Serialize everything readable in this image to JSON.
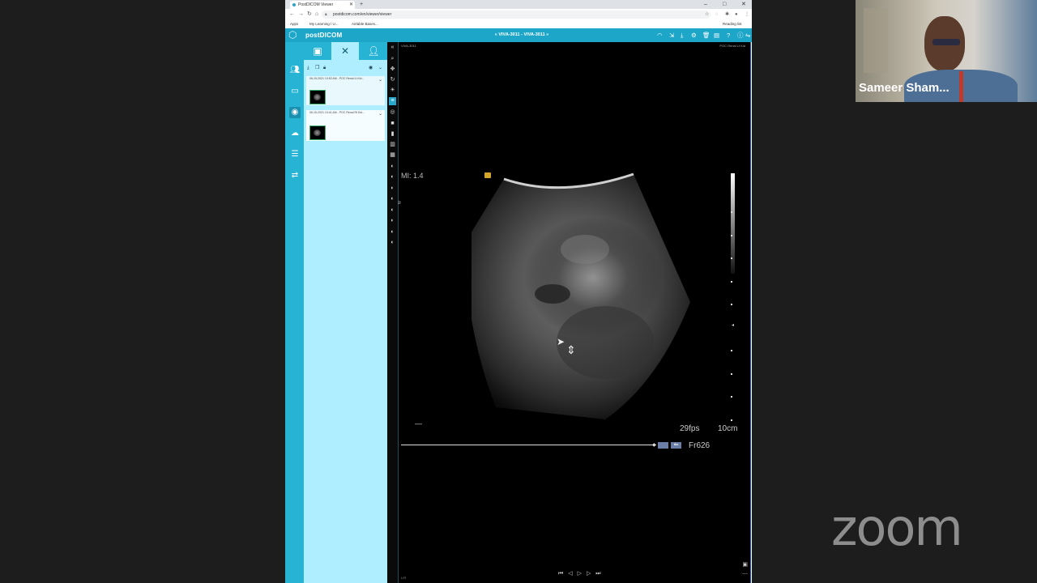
{
  "browser": {
    "tab_title": "PostDICOM Viewer",
    "url": "postdicom.com/en/viewer/viewer",
    "bookmarks": [
      "Apps",
      "My Learning / U...",
      "Airtable Bases..."
    ],
    "reading_list": "Reading list"
  },
  "postdicom": {
    "logo": "postDICOM",
    "patient_title": "VIVA-3011 - VIVA-3011",
    "study_headers": [
      "06-15-2021 10:52 AM - POC Renal Lt Kid...",
      "06-15-2021 10:41 AM - POC Renal Rt Kid..."
    ]
  },
  "viewer": {
    "top_left": "VIVA-3011",
    "top_right": "POC Renal Lt Kid",
    "mi": "MI: 1.4",
    "fps": "29fps",
    "depth": "10cm",
    "frame": "Fr626",
    "dash": "—",
    "bottom_left": "L/R"
  },
  "meeting": {
    "participant_name": "Sameer Sham...",
    "zoom_logo": "zoom"
  },
  "colors": {
    "accent": "#1ea6c8",
    "sidenav": "#27b3d3",
    "panel": "#aeeefe"
  }
}
